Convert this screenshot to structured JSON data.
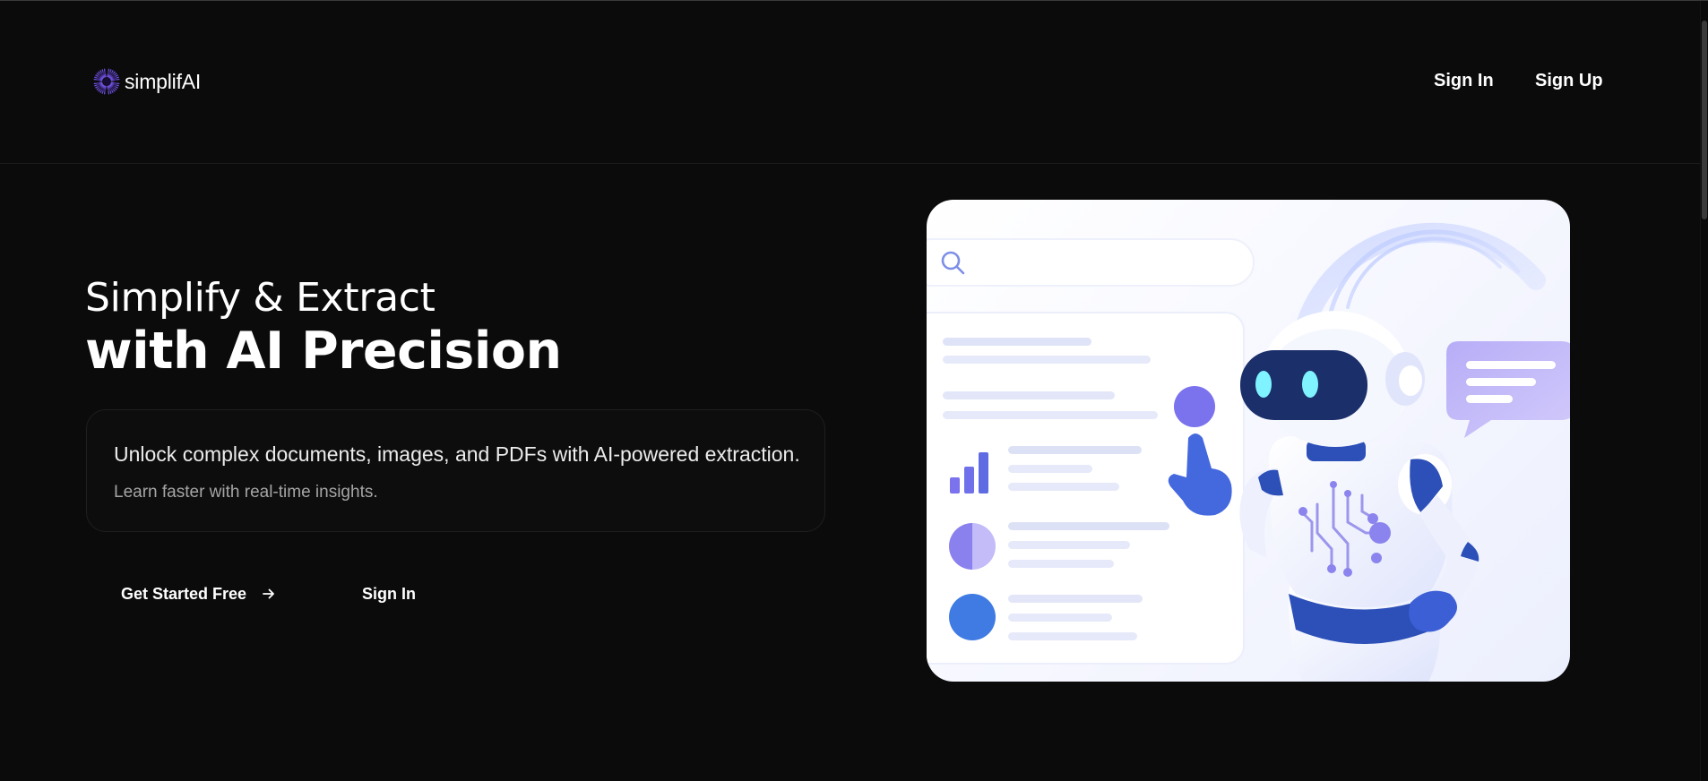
{
  "brand": {
    "name": "simplifAI",
    "logo_icon": "sunburst-logo-icon",
    "accent": "#6b4fd8"
  },
  "nav": {
    "sign_in": "Sign In",
    "sign_up": "Sign Up"
  },
  "hero": {
    "title_line1": "Simplify & Extract",
    "title_line2": "with AI Precision",
    "description": "Unlock complex documents, images, and PDFs with AI-powered extraction.",
    "subtext": "Learn faster with real-time insights."
  },
  "actions": {
    "primary_label": "Get Started Free",
    "primary_icon": "arrow-right-icon",
    "secondary_label": "Sign In"
  },
  "illustration": {
    "subject": "robot-assistant-illustration",
    "colors": {
      "blue": "#3d6fe0",
      "violet": "#7a72ee",
      "light_violet": "#b9b0f7",
      "eye_cyan": "#7ff3ff"
    }
  },
  "colors": {
    "background": "#0b0b0b",
    "text": "#ffffff",
    "muted": "#a5a5a5"
  }
}
